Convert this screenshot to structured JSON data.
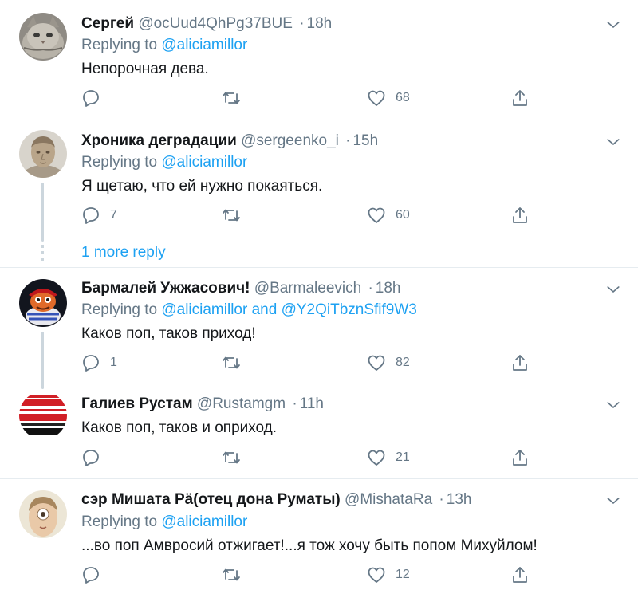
{
  "tweets": [
    {
      "name": "Сергей",
      "handle": "@ocUud4QhPg37BUE",
      "time": "18h",
      "replying_prefix": "Replying to ",
      "replying_to": "@aliciamillor",
      "text": "Непорочная дева.",
      "replies": "",
      "likes": "68",
      "avatar": "cat-photo"
    },
    {
      "name": "Хроника деградации",
      "handle": "@sergeenko_i",
      "time": "15h",
      "replying_prefix": "Replying to ",
      "replying_to": "@aliciamillor",
      "text": "Я щетаю, что ей нужно покаяться.",
      "replies": "7",
      "likes": "60",
      "avatar": "statue-bust"
    },
    {
      "name": "Бармалей Ужжасович!",
      "handle": "@Barmaleevich",
      "time": "18h",
      "replying_prefix": "Replying to ",
      "replying_to": "@aliciamillor and @Y2QiTbznSfif9W3",
      "text": "Каков поп, таков приход!",
      "replies": "1",
      "likes": "82",
      "avatar": "cartoon-pirate"
    },
    {
      "name": "Галиев Рустам",
      "handle": "@Rustamgm",
      "time": "11h",
      "text": "Каков поп, таков и оприход.",
      "replies": "",
      "likes": "21",
      "avatar": "poster-text"
    },
    {
      "name": "сэр Мишата Рä(отец дона Руматы)",
      "handle": "@MishataRa",
      "time": "13h",
      "replying_prefix": "Replying to ",
      "replying_to": "@aliciamillor",
      "text": "...во поп Амвросий отжигает!...я тож хочу быть попом Михуйлом!",
      "replies": "",
      "likes": "12",
      "avatar": "cyclops-face"
    }
  ],
  "more_reply_label": "1 more reply",
  "dot_separator": "·",
  "colors": {
    "link": "#1da1f2",
    "muted": "#657786",
    "text": "#14171a",
    "separator": "#e6ecf0"
  },
  "icons": [
    "reply-icon",
    "retweet-icon",
    "like-icon",
    "share-icon",
    "chevron-down-icon"
  ]
}
